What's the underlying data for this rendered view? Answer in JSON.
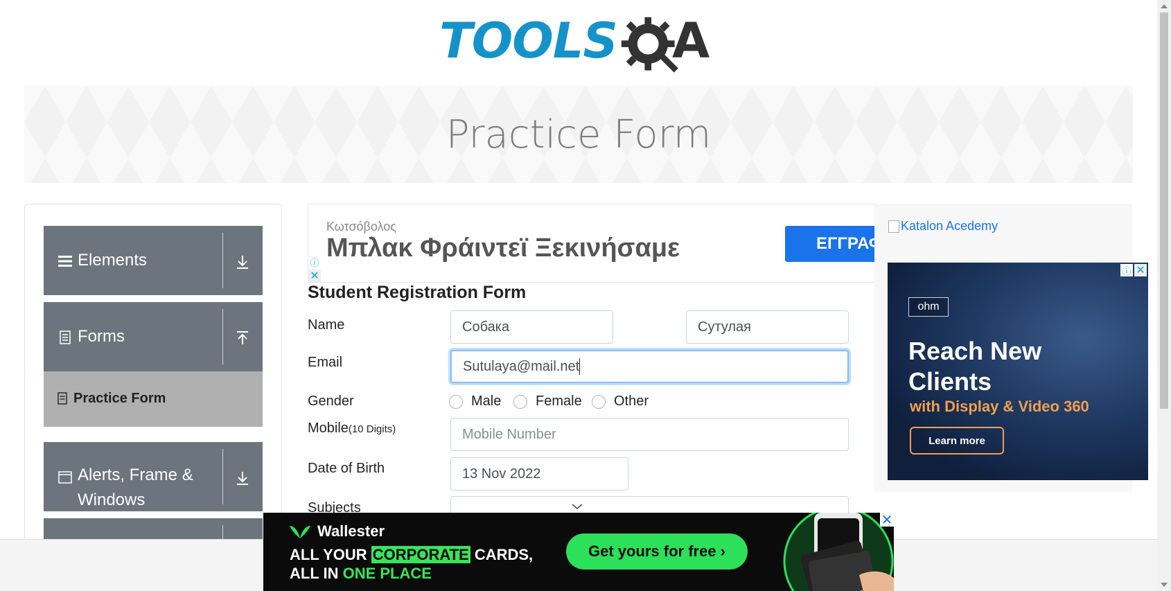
{
  "logo": {
    "text": "TOOLS",
    "letter_a": "A",
    "brand_color": "#1592c9"
  },
  "banner": {
    "title": "Practice Form"
  },
  "sidebar": {
    "groups": [
      {
        "label": "Elements",
        "icon": "hamburger-icon",
        "arrow": "download-arrow-icon"
      },
      {
        "label": "Forms",
        "icon": "document-icon",
        "arrow": "upload-arrow-icon"
      },
      {
        "label": "Alerts, Frame & Windows",
        "label_line1": "Alerts, Frame &",
        "label_line2": "Windows",
        "icon": "window-icon",
        "arrow": "download-arrow-icon"
      }
    ],
    "active_item": {
      "label": "Practice Form",
      "icon": "form-icon"
    }
  },
  "top_ad": {
    "small_text": "Κωτσόβολος",
    "headline": "Μπλακ Φράιντεϊ Ξεκινήσαμε",
    "cta": "ΕΓΓΡΑΦ",
    "cta_color": "#1a73e8"
  },
  "form": {
    "title": "Student Registration Form",
    "name_label": "Name",
    "first_name_value": "Собака",
    "last_name_value": "Сутулая",
    "email_label": "Email",
    "email_value": "Sutulaya@mail.net",
    "gender_label": "Gender",
    "gender_options": [
      "Male",
      "Female",
      "Other"
    ],
    "mobile_label": "Mobile",
    "mobile_hint": "(10 Digits)",
    "mobile_placeholder": "Mobile Number",
    "dob_label": "Date of Birth",
    "dob_value": "13 Nov 2022",
    "subjects_label": "Subjects",
    "focus_color": "#80bdff"
  },
  "right_ads": {
    "katalon_alt": "Katalon Acedemy",
    "ohm": {
      "logo": "ohm",
      "headline_line1": "Reach New",
      "headline_line2": "Clients",
      "subline": "with Display & Video 360",
      "button": "Learn more"
    }
  },
  "bottom_ad": {
    "brand": "Wallester",
    "line1_a": "ALL YOUR ",
    "line1_highlight": "CORPORATE",
    "line1_b": " CARDS,",
    "line2_a": "ALL IN ",
    "line2_highlight": "ONE PLACE",
    "cta": "Get yours for free ›",
    "accent": "#2ce05a"
  }
}
